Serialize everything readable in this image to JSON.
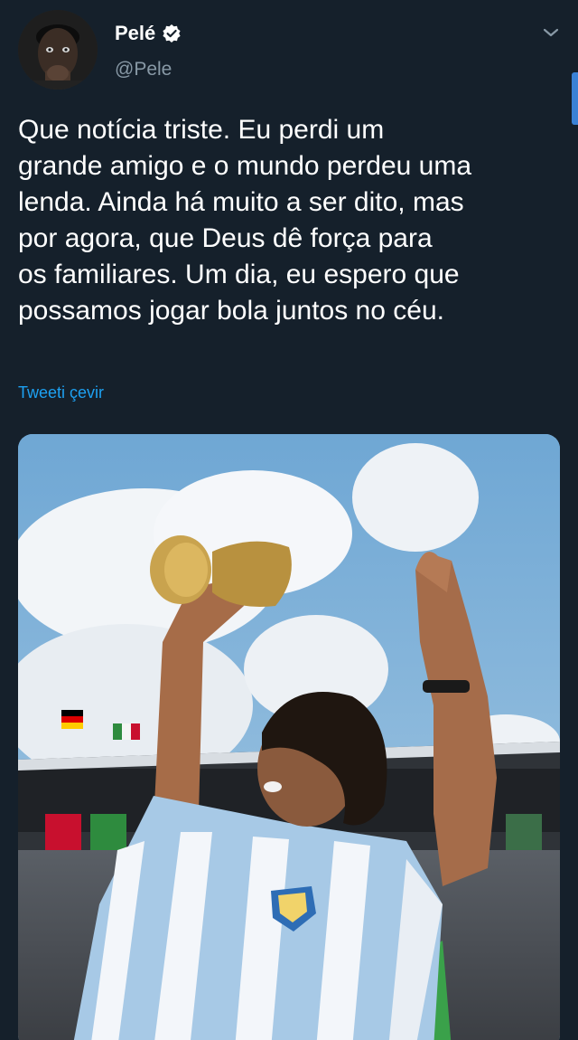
{
  "author": {
    "display_name": "Pelé",
    "handle": "@Pele",
    "verified": true,
    "avatar_icon": "portrait-avatar"
  },
  "tweet": {
    "text": "Que notícia triste. Eu perdi um\ngrande amigo e o mundo perdeu uma\nlenda. Ainda há muito a ser dito, mas\npor agora, que Deus dê força para\nos familiares. Um dia, eu espero que\npossamos jogar bola juntos no céu.",
    "translate_label": "Tweeti çevir"
  },
  "colors": {
    "background": "#15202b",
    "link": "#1da1f2",
    "secondary_text": "#8899a6"
  },
  "icons": {
    "verified": "verified-badge-icon",
    "menu": "chevron-down-icon"
  }
}
